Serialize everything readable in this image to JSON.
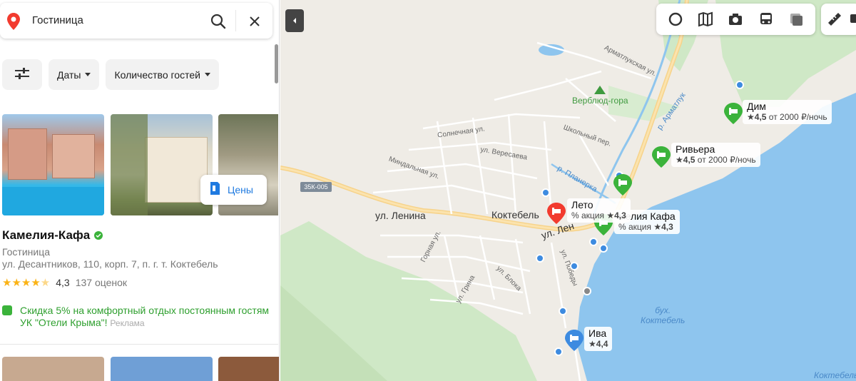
{
  "search": {
    "query": "Гостиница"
  },
  "filters": {
    "settings_icon": "sliders-icon",
    "dates_label": "Даты",
    "guests_label": "Количество гостей"
  },
  "result": {
    "prices_label": "Цены",
    "title": "Камелия-Кафа",
    "category": "Гостиница",
    "address": "ул. Десантников, 110, корп. 7, п. г. т. Коктебель",
    "rating_value": "4,3",
    "rating_stars": 4.3,
    "reviews": "137 оценок",
    "promo_text": "Скидка 5% на комфортный отдых постоянным гостям УК \"Отели Крыма\"!",
    "promo_ad": "Реклама"
  },
  "map": {
    "places": {
      "verblyud": "Верблюд-гора",
      "koktebel": "Коктебель",
      "bay": "бух.\nКоктебель",
      "bay_corner": "Коктебель"
    },
    "roads": {
      "shield": "35К-005",
      "lenina_w": "ул. Ленина",
      "lenina_e": "ул. Лен",
      "armatlukskaya": "Арматлукская ул.",
      "solnechnaya": "Солнечная ул.",
      "veresaeva": "ул. Вересаева",
      "shkolny": "Школьный пер.",
      "mindalnaya": "Миндальная ул.",
      "gornaya": "Горная ул.",
      "bloka": "ул. Блока",
      "grina": "ул. Грина",
      "pobedy": "ул. Победы"
    },
    "rivers": {
      "armatluk": "р. Арматлук",
      "planerka": "р. Планерка"
    },
    "hotels": [
      {
        "name": "Дим",
        "rating": "4,5",
        "price": "от 2000 ₽/ночь",
        "color": "#3bb33b"
      },
      {
        "name": "Ривьера",
        "rating": "4,5",
        "price": "от 2000 ₽/ночь",
        "color": "#3bb33b"
      },
      {
        "name": "Лето",
        "rating": "4,3",
        "promo": "% акция",
        "color": "#f23b2f"
      },
      {
        "name": "мелия Кафа",
        "rating": "4,3",
        "promo": "% акция",
        "color": "#3bb33b"
      },
      {
        "name": "Ива",
        "rating": "4,4",
        "color": "#3d8be0"
      }
    ]
  },
  "colors": {
    "accent_blue": "#1f7ae0",
    "promo_green": "#2e9f2e",
    "star_yellow": "#fbb316",
    "sea": "#8ec5ee",
    "forest": "#cfe8c6"
  }
}
